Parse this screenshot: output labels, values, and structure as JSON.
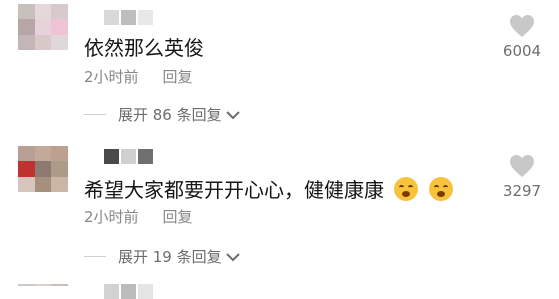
{
  "comments": [
    {
      "text": "依然那么英俊",
      "time": "2小时前",
      "reply_label": "回复",
      "likes": "6004",
      "expand_label": "展开 86 条回复",
      "avatar_colors": [
        "#c7c0bd",
        "#e6d8da",
        "#d7c9cc",
        "#b7a6a6",
        "#e7d2d9",
        "#eec3d3",
        "#c2b6b6",
        "#d8c8c8",
        "#e0d7da"
      ],
      "name_colors": [
        "#d8d8d8",
        "#bdbdbd",
        "#e8e8e8"
      ]
    },
    {
      "text": "希望大家都要开开心心，健健康康",
      "time": "2小时前",
      "reply_label": "回复",
      "likes": "3297",
      "expand_label": "展开 19 条回复",
      "avatar_colors": [
        "#b89f96",
        "#c2a99a",
        "#bda18e",
        "#c0322f",
        "#8f7a72",
        "#ad9a88",
        "#d6c5bc",
        "#a6907d",
        "#c9b6a6"
      ],
      "name_colors": [
        "#4a4a4a",
        "#cfcfcf",
        "#6f6f6f"
      ]
    },
    {
      "avatar_colors": [
        "#cfc9c5",
        "#d9d3d0",
        "#c8bfbb"
      ],
      "name_colors": [
        "#d2d2d2",
        "#bcbcbc",
        "#e4e4e4"
      ]
    }
  ],
  "icons": {
    "like": "heart-icon",
    "expand": "chevron-down-icon",
    "emoji": "tired-face-emoji-icon"
  }
}
